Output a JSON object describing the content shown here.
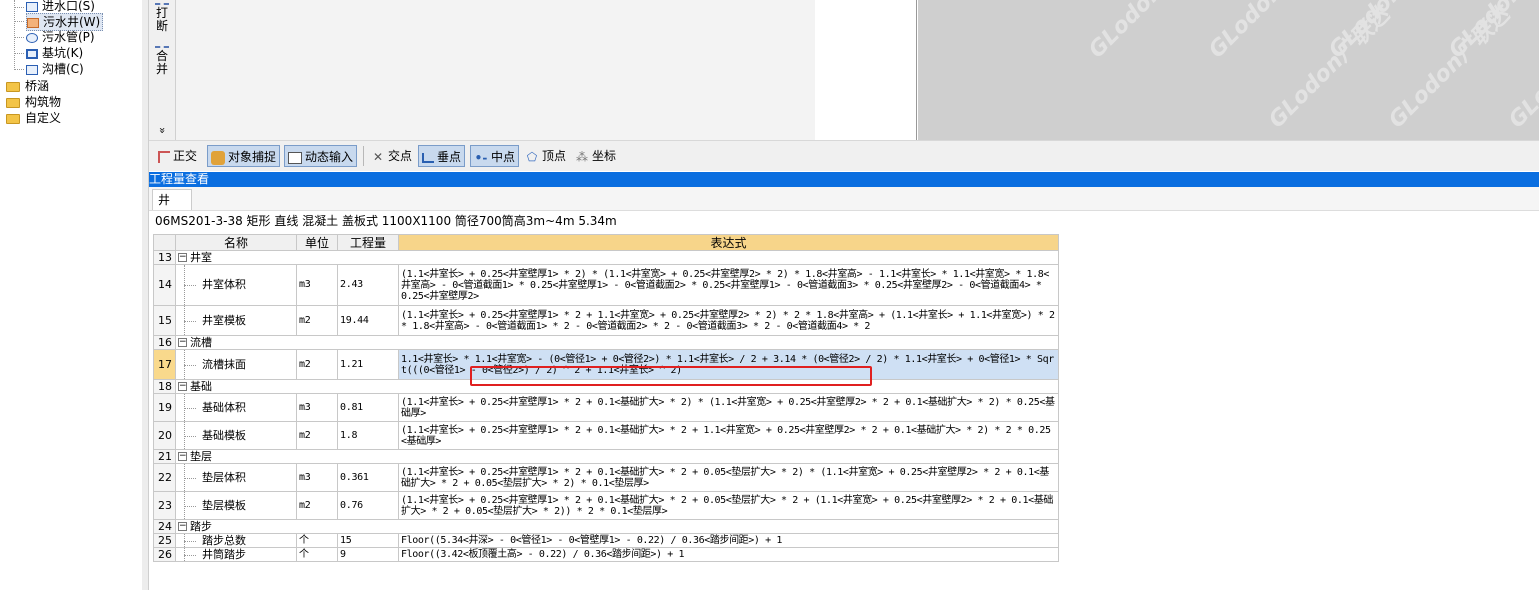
{
  "tree": {
    "items": [
      {
        "label": "进水口(S)",
        "icon": "pipe-icon"
      },
      {
        "label": "污水井(W)",
        "icon": "manhole-icon",
        "selected": true
      },
      {
        "label": "污水管(P)",
        "icon": "pipe-icon"
      },
      {
        "label": "基坑(K)",
        "icon": "pit-icon"
      },
      {
        "label": "沟槽(C)",
        "icon": "trench-icon"
      }
    ],
    "folders": [
      "桥涵",
      "构筑物",
      "自定义"
    ]
  },
  "vtoolbar": {
    "break_label": "打断",
    "merge_label": "合并",
    "more_label": "»"
  },
  "snapbar": {
    "ortho": "正交",
    "object_snap": "对象捕捉",
    "dynamic_input": "动态输入",
    "intersection": "交点",
    "perpendicular": "垂点",
    "midpoint": "中点",
    "vertex": "顶点",
    "coordinate": "坐标"
  },
  "watermark": "GLodon广联达",
  "panel": {
    "title": "工程量查看",
    "tab": "井",
    "spec": "06MS201-3-38 矩形 直线 混凝土 盖板式 1100X1100 筒径700筒高3m~4m 5.34m"
  },
  "table": {
    "headers": {
      "name": "名称",
      "unit": "单位",
      "qty": "工程量",
      "expr": "表达式"
    },
    "rows": [
      {
        "no": "13",
        "group": true,
        "name": "井室"
      },
      {
        "no": "14",
        "name": "井室体积",
        "unit": "m3",
        "qty": "2.43",
        "expr": "(1.1<井室长> + 0.25<井室壁厚1> * 2) * (1.1<井室宽> + 0.25<井室壁厚2> * 2) * 1.8<井室高> - 1.1<井室长> * 1.1<井室宽> * 1.8<井室高> - 0<管道截面1> * 0.25<井室壁厚1> - 0<管道截面2> * 0.25<井室壁厚1> - 0<管道截面3> * 0.25<井室壁厚2> - 0<管道截面4> * 0.25<井室壁厚2>"
      },
      {
        "no": "15",
        "name": "井室模板",
        "unit": "m2",
        "qty": "19.44",
        "expr": "(1.1<井室长> + 0.25<井室壁厚1> * 2 + 1.1<井室宽> + 0.25<井室壁厚2> * 2) * 2 * 1.8<井室高> + (1.1<井室长> + 1.1<井室宽>) * 2 * 1.8<井室高> - 0<管道截面1> * 2 - 0<管道截面2> * 2 - 0<管道截面3> * 2 - 0<管道截面4> * 2"
      },
      {
        "no": "16",
        "group": true,
        "name": "流槽"
      },
      {
        "no": "17",
        "name": "流槽抹面",
        "unit": "m2",
        "qty": "1.21",
        "expr": "1.1<井室长> * 1.1<井室宽> - (0<管径1> + 0<管径2>) * 1.1<井室长> / 2 + 3.14 * (0<管径2> / 2) * 1.1<井室长> + 0<管径1> * Sqrt(((0<管径1> - 0<管径2>) / 2) ^ 2 + 1.1<井室长> ^ 2)",
        "selected": true
      },
      {
        "no": "18",
        "group": true,
        "name": "基础"
      },
      {
        "no": "19",
        "name": "基础体积",
        "unit": "m3",
        "qty": "0.81",
        "expr": "(1.1<井室长> + 0.25<井室壁厚1> * 2 + 0.1<基础扩大> * 2) * (1.1<井室宽> + 0.25<井室壁厚2> * 2 + 0.1<基础扩大> * 2) * 0.25<基础厚>"
      },
      {
        "no": "20",
        "name": "基础模板",
        "unit": "m2",
        "qty": "1.8",
        "expr": "(1.1<井室长> + 0.25<井室壁厚1> * 2 + 0.1<基础扩大> * 2 + 1.1<井室宽> + 0.25<井室壁厚2> * 2 + 0.1<基础扩大> * 2) * 2 * 0.25<基础厚>"
      },
      {
        "no": "21",
        "group": true,
        "name": "垫层"
      },
      {
        "no": "22",
        "name": "垫层体积",
        "unit": "m3",
        "qty": "0.361",
        "expr": "(1.1<井室长> + 0.25<井室壁厚1> * 2 + 0.1<基础扩大> * 2 + 0.05<垫层扩大> * 2) * (1.1<井室宽> + 0.25<井室壁厚2> * 2 + 0.1<基础扩大> * 2 + 0.05<垫层扩大> * 2) * 0.1<垫层厚>"
      },
      {
        "no": "23",
        "name": "垫层模板",
        "unit": "m2",
        "qty": "0.76",
        "expr": "(1.1<井室长> + 0.25<井室壁厚1> * 2 + 0.1<基础扩大> * 2 + 0.05<垫层扩大> * 2 + (1.1<井室宽> + 0.25<井室壁厚2> * 2 + 0.1<基础扩大> * 2 + 0.05<垫层扩大> * 2)) * 2 * 0.1<垫层厚>"
      },
      {
        "no": "24",
        "group": true,
        "name": "踏步"
      },
      {
        "no": "25",
        "name": "踏步总数",
        "unit": "个",
        "qty": "15",
        "expr": "Floor((5.34<井深> - 0<管径1> - 0<管壁厚1> - 0.22) / 0.36<踏步间距>) + 1"
      },
      {
        "no": "26",
        "name": "井筒踏步",
        "unit": "个",
        "qty": "9",
        "expr": "Floor((3.42<板顶覆土高> - 0.22) / 0.36<踏步间距>) + 1"
      }
    ]
  }
}
